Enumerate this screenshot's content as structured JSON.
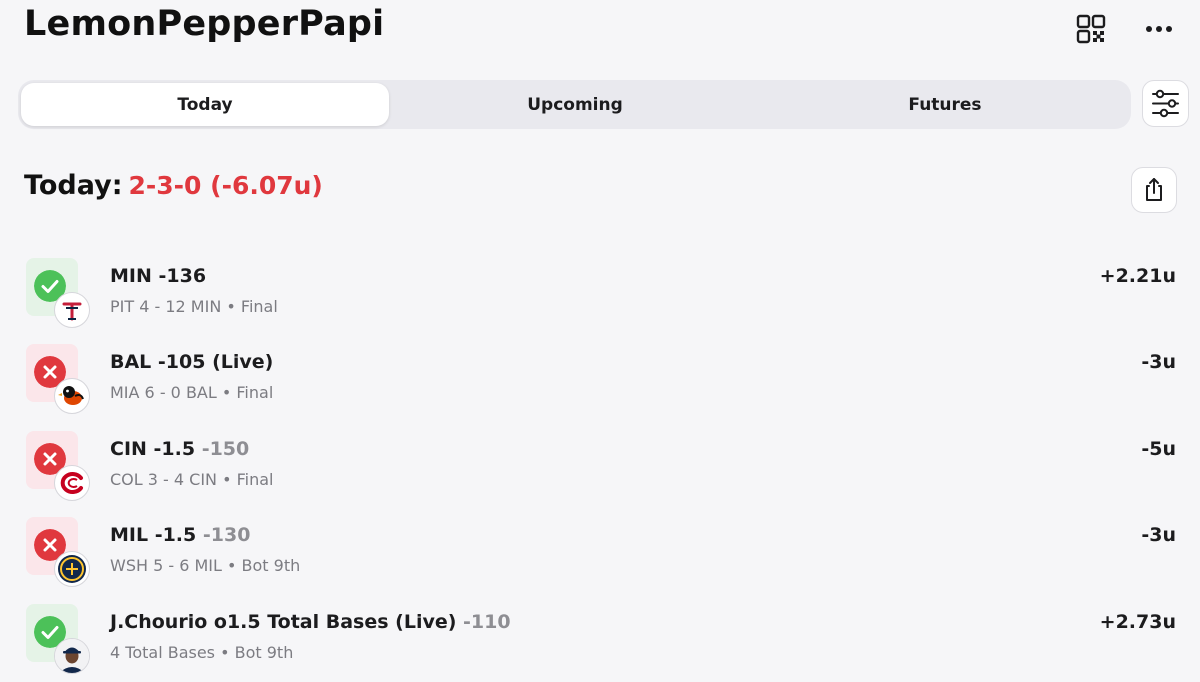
{
  "header": {
    "username": "LemonPepperPapi",
    "qr_icon": "qr-code-icon",
    "more_icon": "more-horizontal-icon"
  },
  "tabs": [
    {
      "label": "Today",
      "active": true
    },
    {
      "label": "Upcoming",
      "active": false
    },
    {
      "label": "Futures",
      "active": false
    }
  ],
  "filter_icon": "sliders-icon",
  "summary": {
    "label": "Today:",
    "record": "2-3-0 (-6.07u)",
    "record_color": "#e0383e",
    "share_icon": "share-icon"
  },
  "colors": {
    "win": "#4cc159",
    "loss": "#e0383e"
  },
  "bets": [
    {
      "result": "win",
      "title": "MIN -136",
      "odds": "",
      "detail": "PIT 4 - 12 MIN • Final",
      "units": "+2.21u",
      "logo": "twins-logo"
    },
    {
      "result": "loss",
      "title": "BAL -105 (Live)",
      "odds": "",
      "detail": "MIA 6 - 0 BAL • Final",
      "units": "-3u",
      "logo": "orioles-logo"
    },
    {
      "result": "loss",
      "title": "CIN -1.5",
      "odds": "-150",
      "detail": "COL 3 - 4 CIN • Final",
      "units": "-5u",
      "logo": "reds-logo"
    },
    {
      "result": "loss",
      "title": "MIL -1.5",
      "odds": "-130",
      "detail": "WSH 5 - 6 MIL • Bot 9th",
      "units": "-3u",
      "logo": "brewers-logo"
    },
    {
      "result": "win",
      "title": "J.Chourio o1.5 Total Bases (Live)",
      "odds": "-110",
      "detail": "4 Total Bases • Bot 9th",
      "units": "+2.73u",
      "logo": "player-avatar"
    }
  ]
}
